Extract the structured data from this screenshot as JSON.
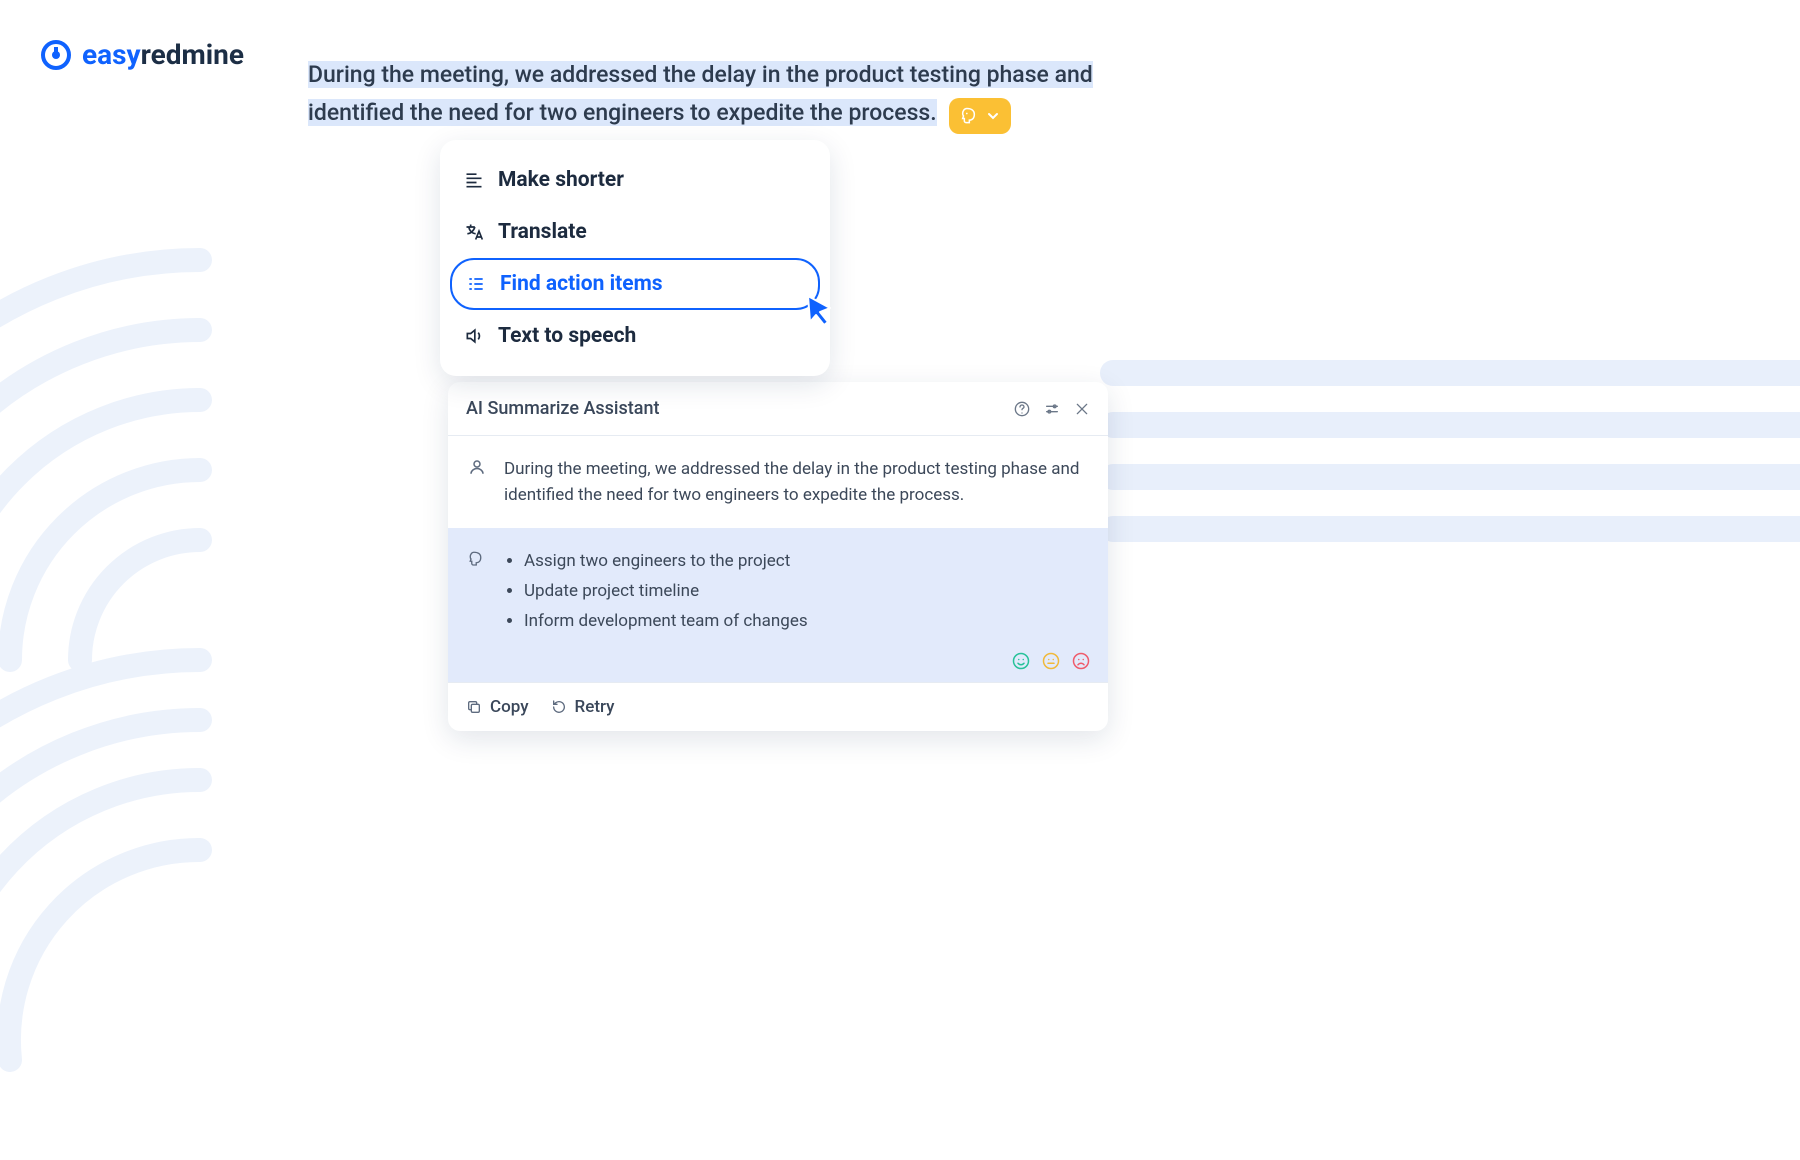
{
  "brand": {
    "easy": "easy",
    "redmine": "redmine"
  },
  "selected_text": "During the meeting, we addressed the delay in the product testing phase and identified the need for two engineers to expedite the process.",
  "menu": {
    "items": [
      {
        "label": "Make shorter"
      },
      {
        "label": "Translate"
      },
      {
        "label": "Find action items"
      },
      {
        "label": "Text to speech"
      }
    ]
  },
  "assistant": {
    "title": "AI Summarize Assistant",
    "user_text": "During the meeting, we addressed the delay in the product testing phase and identified the need for two engineers to expedite the process.",
    "ai_items": [
      "Assign two engineers to the project",
      "Update project timeline",
      "Inform development team of changes"
    ],
    "footer": {
      "copy": "Copy",
      "retry": "Retry"
    }
  },
  "colors": {
    "primary": "#0f62fe",
    "accent": "#fbc034",
    "highlight": "#dbe7fb",
    "aiblock": "#e2eafb"
  }
}
